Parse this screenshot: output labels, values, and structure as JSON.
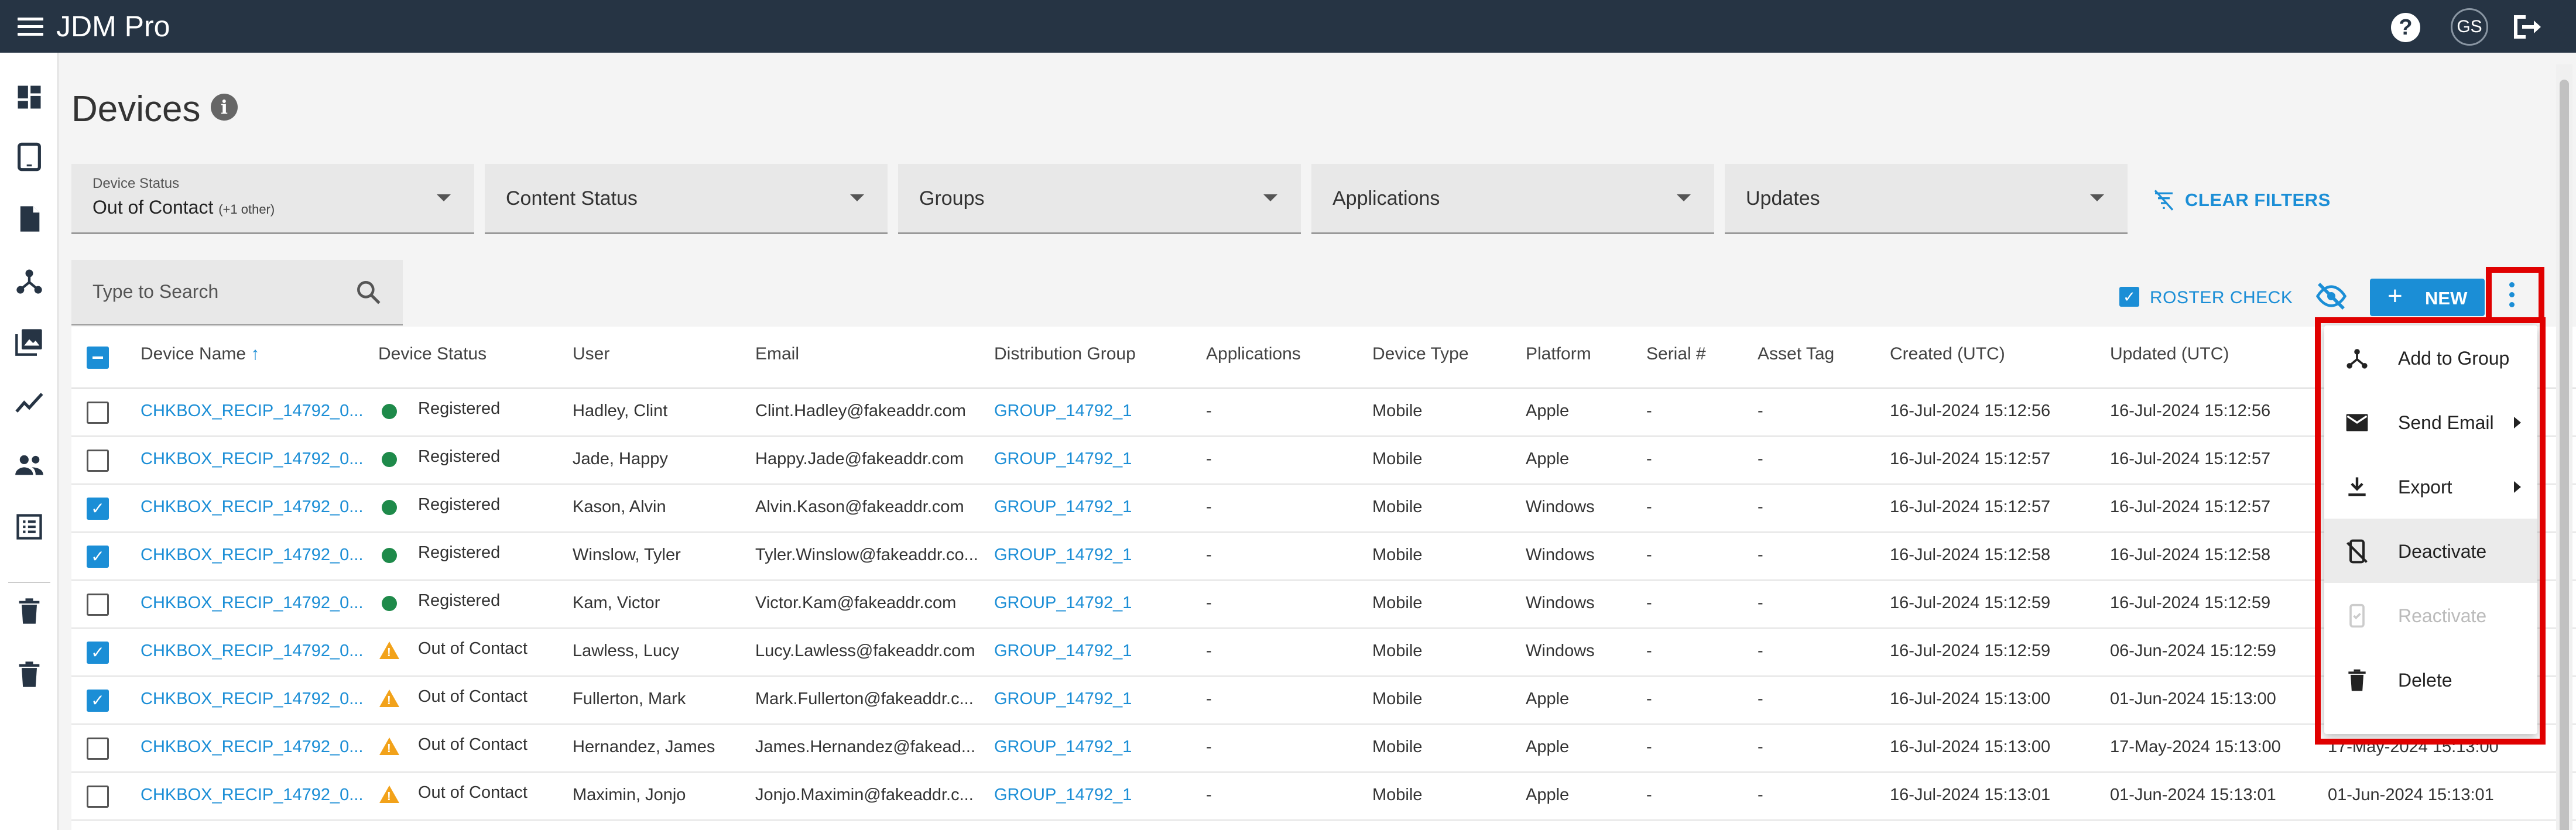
{
  "app": {
    "title": "JDM Pro",
    "user_initials": "GS"
  },
  "page": {
    "title": "Devices"
  },
  "filters": [
    {
      "label": "Device Status",
      "value": "Out of Contact",
      "extra": "(+1 other)"
    },
    {
      "label": "",
      "value": "Content Status",
      "extra": ""
    },
    {
      "label": "",
      "value": "Groups",
      "extra": ""
    },
    {
      "label": "",
      "value": "Applications",
      "extra": ""
    },
    {
      "label": "",
      "value": "Updates",
      "extra": ""
    }
  ],
  "clear_filters": "CLEAR FILTERS",
  "search": {
    "placeholder": "Type to Search"
  },
  "toolbar": {
    "roster_check": "ROSTER CHECK",
    "new_label": "NEW"
  },
  "table": {
    "columns": [
      "Device Name",
      "Device Status",
      "User",
      "Email",
      "Distribution Group",
      "Applications",
      "Device Type",
      "Platform",
      "Serial #",
      "Asset Tag",
      "Created (UTC)",
      "Updated (UTC)"
    ],
    "rows": [
      {
        "checked": false,
        "name": "CHKBOX_RECIP_14792_0...",
        "status": "Registered",
        "status_kind": "ok",
        "user": "Hadley, Clint",
        "email": "Clint.Hadley@fakeaddr.com",
        "group": "GROUP_14792_1",
        "apps": "-",
        "type": "Mobile",
        "platform": "Apple",
        "serial": "-",
        "asset": "-",
        "created": "16-Jul-2024 15:12:56",
        "updated": "16-Jul-2024 15:12:56",
        "extra": ""
      },
      {
        "checked": false,
        "name": "CHKBOX_RECIP_14792_0...",
        "status": "Registered",
        "status_kind": "ok",
        "user": "Jade, Happy",
        "email": "Happy.Jade@fakeaddr.com",
        "group": "GROUP_14792_1",
        "apps": "-",
        "type": "Mobile",
        "platform": "Apple",
        "serial": "-",
        "asset": "-",
        "created": "16-Jul-2024 15:12:57",
        "updated": "16-Jul-2024 15:12:57",
        "extra": ""
      },
      {
        "checked": true,
        "name": "CHKBOX_RECIP_14792_0...",
        "status": "Registered",
        "status_kind": "ok",
        "user": "Kason, Alvin",
        "email": "Alvin.Kason@fakeaddr.com",
        "group": "GROUP_14792_1",
        "apps": "-",
        "type": "Mobile",
        "platform": "Windows",
        "serial": "-",
        "asset": "-",
        "created": "16-Jul-2024 15:12:57",
        "updated": "16-Jul-2024 15:12:57",
        "extra": ""
      },
      {
        "checked": true,
        "name": "CHKBOX_RECIP_14792_0...",
        "status": "Registered",
        "status_kind": "ok",
        "user": "Winslow, Tyler",
        "email": "Tyler.Winslow@fakeaddr.co...",
        "group": "GROUP_14792_1",
        "apps": "-",
        "type": "Mobile",
        "platform": "Windows",
        "serial": "-",
        "asset": "-",
        "created": "16-Jul-2024 15:12:58",
        "updated": "16-Jul-2024 15:12:58",
        "extra": ""
      },
      {
        "checked": false,
        "name": "CHKBOX_RECIP_14792_0...",
        "status": "Registered",
        "status_kind": "ok",
        "user": "Kam, Victor",
        "email": "Victor.Kam@fakeaddr.com",
        "group": "GROUP_14792_1",
        "apps": "-",
        "type": "Mobile",
        "platform": "Windows",
        "serial": "-",
        "asset": "-",
        "created": "16-Jul-2024 15:12:59",
        "updated": "16-Jul-2024 15:12:59",
        "extra": ""
      },
      {
        "checked": true,
        "name": "CHKBOX_RECIP_14792_0...",
        "status": "Out of Contact",
        "status_kind": "warn",
        "user": "Lawless, Lucy",
        "email": "Lucy.Lawless@fakeaddr.com",
        "group": "GROUP_14792_1",
        "apps": "-",
        "type": "Mobile",
        "platform": "Windows",
        "serial": "-",
        "asset": "-",
        "created": "16-Jul-2024 15:12:59",
        "updated": "06-Jun-2024 15:12:59",
        "extra": ""
      },
      {
        "checked": true,
        "name": "CHKBOX_RECIP_14792_0...",
        "status": "Out of Contact",
        "status_kind": "warn",
        "user": "Fullerton, Mark",
        "email": "Mark.Fullerton@fakeaddr.c...",
        "group": "GROUP_14792_1",
        "apps": "-",
        "type": "Mobile",
        "platform": "Apple",
        "serial": "-",
        "asset": "-",
        "created": "16-Jul-2024 15:13:00",
        "updated": "01-Jun-2024 15:13:00",
        "extra": ""
      },
      {
        "checked": false,
        "name": "CHKBOX_RECIP_14792_0...",
        "status": "Out of Contact",
        "status_kind": "warn",
        "user": "Hernandez, James",
        "email": "James.Hernandez@fakead...",
        "group": "GROUP_14792_1",
        "apps": "-",
        "type": "Mobile",
        "platform": "Apple",
        "serial": "-",
        "asset": "-",
        "created": "16-Jul-2024 15:13:00",
        "updated": "17-May-2024 15:13:00",
        "extra": "17-May-2024 15:13:00"
      },
      {
        "checked": false,
        "name": "CHKBOX_RECIP_14792_0...",
        "status": "Out of Contact",
        "status_kind": "warn",
        "user": "Maximin, Jonjo",
        "email": "Jonjo.Maximin@fakeaddr.c...",
        "group": "GROUP_14792_1",
        "apps": "-",
        "type": "Mobile",
        "platform": "Apple",
        "serial": "-",
        "asset": "-",
        "created": "16-Jul-2024 15:13:01",
        "updated": "01-Jun-2024 15:13:01",
        "extra": "01-Jun-2024 15:13:01"
      }
    ]
  },
  "menu": {
    "items": [
      {
        "label": "Add to Group",
        "icon": "hub-icon",
        "submenu": false,
        "disabled": false
      },
      {
        "label": "Send Email",
        "icon": "mail-icon",
        "submenu": true,
        "disabled": false
      },
      {
        "label": "Export",
        "icon": "download-icon",
        "submenu": true,
        "disabled": false
      },
      {
        "label": "Deactivate",
        "icon": "device-off-icon",
        "submenu": false,
        "disabled": false
      },
      {
        "label": "Reactivate",
        "icon": "device-on-icon",
        "submenu": false,
        "disabled": true
      },
      {
        "label": "Delete",
        "icon": "trash-icon",
        "submenu": false,
        "disabled": false
      }
    ]
  },
  "colors": {
    "topbar": "#263444",
    "accent": "#1b8ed6",
    "ok": "#1e8a4a",
    "warn": "#f2a21a",
    "highlight": "#e00000"
  }
}
